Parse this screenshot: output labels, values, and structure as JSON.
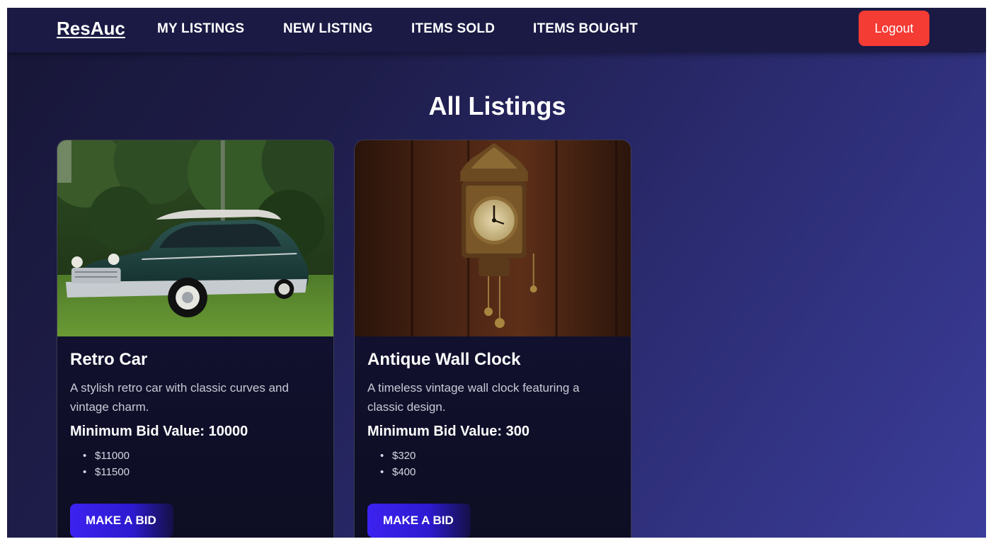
{
  "header": {
    "brand": "ResAuc",
    "nav": [
      "MY LISTINGS",
      "NEW LISTING",
      "ITEMS SOLD",
      "ITEMS BOUGHT"
    ],
    "logout_label": "Logout"
  },
  "main": {
    "title": "All Listings",
    "listings": [
      {
        "title": "Retro Car",
        "description": "A stylish retro car with classic curves and vintage charm.",
        "min_bid": "Minimum Bid Value: 10000",
        "bids": [
          "$11000",
          "$11500"
        ],
        "button_label": "MAKE A BID"
      },
      {
        "title": "Antique Wall Clock",
        "description": "A timeless vintage wall clock featuring a classic design.",
        "min_bid": "Minimum Bid Value: 300",
        "bids": [
          "$320",
          "$400"
        ],
        "button_label": "MAKE A BID"
      }
    ]
  },
  "colors": {
    "accent_logout": "#f43b34",
    "accent_button": "#3d22f0",
    "navbar": "#1a1a44"
  }
}
